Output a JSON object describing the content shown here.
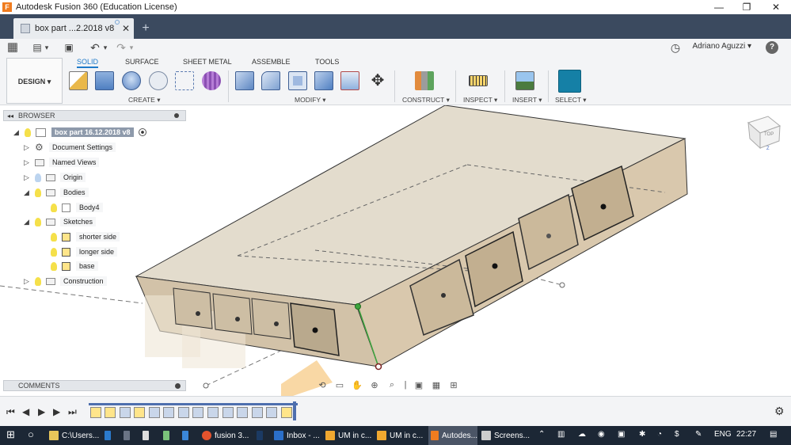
{
  "window": {
    "title": "Autodesk Fusion 360 (Education License)",
    "app_icon_letter": "F",
    "min_glyph": "—",
    "max_glyph": "❐",
    "close_glyph": "✕"
  },
  "document_tab": {
    "label": "box part ...2.2018 v8",
    "close_glyph": "✕",
    "new_tab_glyph": "+"
  },
  "quick_access": {
    "grid_glyph": "▦",
    "file_glyph": "▤",
    "dropdown_glyph": "▾",
    "save_glyph": "▣",
    "undo_glyph": "↶",
    "redo_glyph": "↷",
    "clock_glyph": "◷",
    "user_name": "Adriano Aguzzi ▾",
    "help_glyph": "?"
  },
  "ribbon": {
    "workspace_label": "DESIGN ▾",
    "tabs": [
      "SOLID",
      "SURFACE",
      "SHEET METAL",
      "ASSEMBLE",
      "TOOLS"
    ],
    "active_tab": "SOLID",
    "groups": [
      "CREATE ▾",
      "MODIFY ▾",
      "CONSTRUCT ▾",
      "INSPECT ▾",
      "INSERT ▾",
      "SELECT ▾"
    ],
    "accent_color": "#1f7ac9"
  },
  "browser": {
    "header": "BROWSER",
    "collapse_glyph": "◂◂",
    "root": "box part 16.12.2018 v8",
    "items": [
      {
        "label": "Document Settings"
      },
      {
        "label": "Named Views"
      },
      {
        "label": "Origin"
      },
      {
        "label": "Bodies"
      },
      {
        "label": "Body4"
      },
      {
        "label": "Sketches"
      },
      {
        "label": "shorter side"
      },
      {
        "label": "longer side"
      },
      {
        "label": "base"
      },
      {
        "label": "Construction"
      }
    ]
  },
  "comments": {
    "label": "COMMENTS"
  },
  "viewcube": {
    "face_label": "TOP",
    "axis_label": "Z"
  },
  "timeline": {
    "controls": [
      "⏮",
      "◀",
      "▶",
      "▶",
      "⏭"
    ],
    "settings_glyph": "⚙"
  },
  "taskbar": {
    "start_glyph": "⊞",
    "search_glyph": "○",
    "items": [
      {
        "label": "C:\\Users...",
        "color": "#e8c65a"
      },
      {
        "label": "fusion 3...",
        "color": "#e5532d"
      },
      {
        "label": "Inbox - ...",
        "color": "#2b6fc9"
      },
      {
        "label": "UM in c...",
        "color": "#f0a830"
      },
      {
        "label": "UM in c...",
        "color": "#f0a830"
      },
      {
        "label": "Autodes...",
        "color": "#f07c1f"
      },
      {
        "label": "Screens...",
        "color": "#cccccc"
      }
    ],
    "active_item": "Autodes...",
    "language": "ENG",
    "time": "22:27"
  }
}
